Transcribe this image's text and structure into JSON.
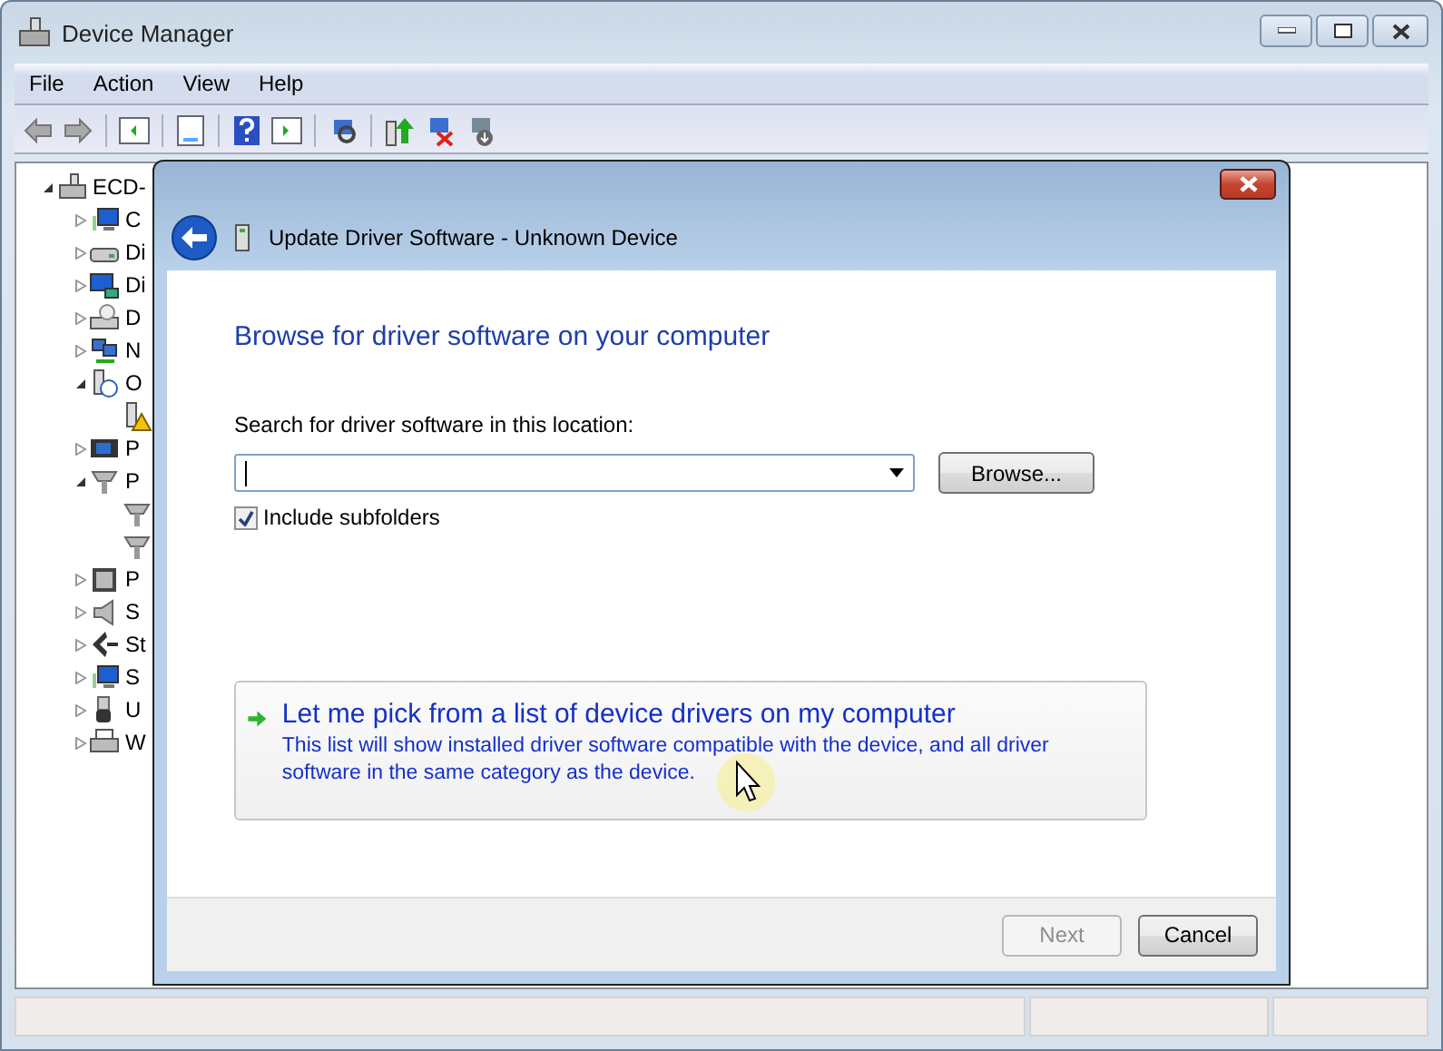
{
  "window": {
    "title": "Device Manager"
  },
  "menu": [
    "File",
    "Action",
    "View",
    "Help"
  ],
  "tree": {
    "label": "ECD-",
    "kind": "computer",
    "expanded": true,
    "children": [
      {
        "label": "C",
        "kind": "monitor",
        "expanded": false
      },
      {
        "label": "Di",
        "kind": "disk",
        "expanded": false
      },
      {
        "label": "Di",
        "kind": "display",
        "expanded": false
      },
      {
        "label": "D",
        "kind": "dvd",
        "expanded": false
      },
      {
        "label": "N",
        "kind": "network",
        "expanded": false
      },
      {
        "label": "O",
        "kind": "unknown",
        "expanded": true,
        "children": [
          {
            "kind": "warning"
          }
        ]
      },
      {
        "label": "P",
        "kind": "pcmcia",
        "expanded": false
      },
      {
        "label": "P",
        "kind": "port",
        "expanded": true,
        "children": [
          {
            "kind": "port"
          },
          {
            "kind": "port"
          }
        ]
      },
      {
        "label": "P",
        "kind": "cpu",
        "expanded": false
      },
      {
        "label": "S",
        "kind": "sound",
        "expanded": false
      },
      {
        "label": "St",
        "kind": "storage",
        "expanded": false
      },
      {
        "label": "S",
        "kind": "monitor",
        "expanded": false
      },
      {
        "label": "U",
        "kind": "usb",
        "expanded": false
      },
      {
        "label": "W",
        "kind": "printer",
        "expanded": false
      }
    ]
  },
  "dialog": {
    "title": "Update Driver Software - Unknown Device",
    "heading": "Browse for driver software on your computer",
    "location_label": "Search for driver software in this location:",
    "browse_button": "Browse...",
    "include_subfolders": {
      "label": "Include subfolders",
      "checked": true
    },
    "command_link": {
      "title": "Let me pick from a list of device drivers on my computer",
      "description": "This list will show installed driver software compatible with the device, and all driver software in the same category as the device."
    },
    "buttons": [
      {
        "label": "Next",
        "disabled": true
      },
      {
        "label": "Cancel",
        "disabled": false
      }
    ]
  }
}
